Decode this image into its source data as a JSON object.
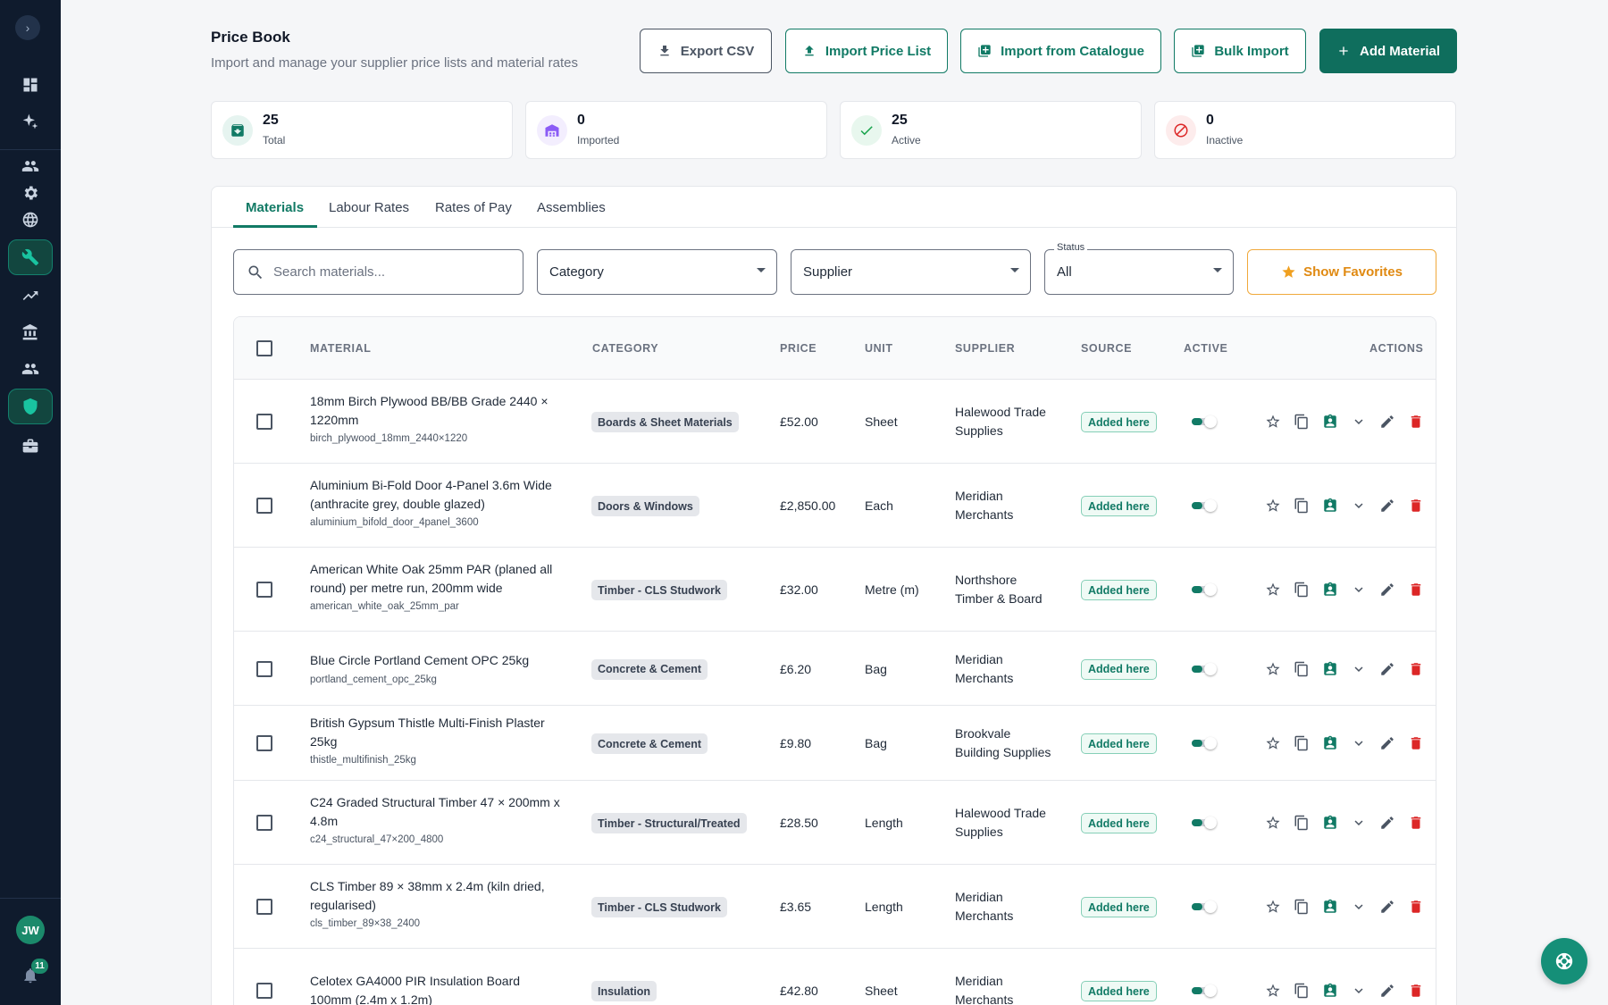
{
  "header": {
    "title": "Price Book",
    "subtitle": "Import and manage your supplier price lists and material rates",
    "buttons": {
      "export": "Export CSV",
      "import_price_list": "Import Price List",
      "import_catalogue": "Import from Catalogue",
      "bulk_import": "Bulk Import",
      "add_material": "Add Material"
    }
  },
  "stats": [
    {
      "value": "25",
      "label": "Total",
      "color": "#117a65"
    },
    {
      "value": "0",
      "label": "Imported",
      "color": "#8b5cf6"
    },
    {
      "value": "25",
      "label": "Active",
      "color": "#16a34a"
    },
    {
      "value": "0",
      "label": "Inactive",
      "color": "#dc2626"
    }
  ],
  "tabs": [
    "Materials",
    "Labour Rates",
    "Rates of Pay",
    "Assemblies"
  ],
  "filters": {
    "search_placeholder": "Search materials...",
    "category": "Category",
    "supplier": "Supplier",
    "status_label": "Status",
    "status_value": "All",
    "favorites": "Show Favorites"
  },
  "table": {
    "columns": [
      "MATERIAL",
      "CATEGORY",
      "PRICE",
      "UNIT",
      "SUPPLIER",
      "SOURCE",
      "ACTIVE",
      "ACTIONS"
    ],
    "rows": [
      {
        "name": "18mm Birch Plywood BB/BB Grade 2440 × 1220mm",
        "code": "birch_plywood_18mm_2440×1220",
        "category": "Boards & Sheet Materials",
        "price": "£52.00",
        "unit": "Sheet",
        "supplier": "Halewood Trade Supplies",
        "source": "Added here",
        "active": true
      },
      {
        "name": "Aluminium Bi-Fold Door 4-Panel 3.6m Wide (anthracite grey, double glazed)",
        "code": "aluminium_bifold_door_4panel_3600",
        "category": "Doors & Windows",
        "price": "£2,850.00",
        "unit": "Each",
        "supplier": "Meridian Merchants",
        "source": "Added here",
        "active": true
      },
      {
        "name": "American White Oak 25mm PAR (planed all round) per metre run, 200mm wide",
        "code": "american_white_oak_25mm_par",
        "category": "Timber - CLS Studwork",
        "price": "£32.00",
        "unit": "Metre (m)",
        "supplier": "Northshore Timber & Board",
        "source": "Added here",
        "active": true
      },
      {
        "name": "Blue Circle Portland Cement OPC 25kg",
        "code": "portland_cement_opc_25kg",
        "category": "Concrete & Cement",
        "price": "£6.20",
        "unit": "Bag",
        "supplier": "Meridian Merchants",
        "source": "Added here",
        "active": true
      },
      {
        "name": "British Gypsum Thistle Multi-Finish Plaster 25kg",
        "code": "thistle_multifinish_25kg",
        "category": "Concrete & Cement",
        "price": "£9.80",
        "unit": "Bag",
        "supplier": "Brookvale Building Supplies",
        "source": "Added here",
        "active": true
      },
      {
        "name": "C24 Graded Structural Timber 47 × 200mm x 4.8m",
        "code": "c24_structural_47×200_4800",
        "category": "Timber - Structural/Treated",
        "price": "£28.50",
        "unit": "Length",
        "supplier": "Halewood Trade Supplies",
        "source": "Added here",
        "active": true
      },
      {
        "name": "CLS Timber 89 × 38mm x 2.4m (kiln dried, regularised)",
        "code": "cls_timber_89×38_2400",
        "category": "Timber - CLS Studwork",
        "price": "£3.65",
        "unit": "Length",
        "supplier": "Meridian Merchants",
        "source": "Added here",
        "active": true
      },
      {
        "name": "Celotex GA4000 PIR Insulation Board 100mm (2.4m x 1.2m)",
        "code": "",
        "category": "Insulation",
        "price": "£42.80",
        "unit": "Sheet",
        "supplier": "Meridian Merchants",
        "source": "Added here",
        "active": true
      }
    ]
  },
  "user": {
    "initials": "JW",
    "notifications": "11"
  },
  "colors": {
    "accent": "#117a65",
    "sidebar": "#0f1b2d",
    "favorite": "#f0a020",
    "danger": "#dc2626"
  }
}
